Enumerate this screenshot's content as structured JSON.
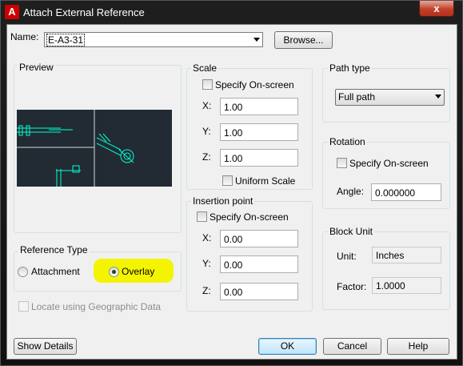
{
  "window": {
    "title": "Attach External Reference",
    "close_glyph": "x"
  },
  "name_field": {
    "label": "Name:",
    "value": "E-A3-31",
    "browse_label": "Browse..."
  },
  "preview": {
    "title": "Preview"
  },
  "reference_type": {
    "title": "Reference Type",
    "options": [
      {
        "label": "Attachment",
        "selected": false
      },
      {
        "label": "Overlay",
        "selected": true
      }
    ],
    "highlight_color": "#f4f400"
  },
  "geo": {
    "label": "Locate using Geographic Data",
    "enabled": false
  },
  "scale": {
    "title": "Scale",
    "specify_label": "Specify On-screen",
    "x_label": "X:",
    "x_value": "1.00",
    "y_label": "Y:",
    "y_value": "1.00",
    "z_label": "Z:",
    "z_value": "1.00",
    "uniform_label": "Uniform Scale"
  },
  "insertion": {
    "title": "Insertion point",
    "specify_label": "Specify On-screen",
    "x_label": "X:",
    "x_value": "0.00",
    "y_label": "Y:",
    "y_value": "0.00",
    "z_label": "Z:",
    "z_value": "0.00"
  },
  "path_type": {
    "title": "Path type",
    "value": "Full path"
  },
  "rotation": {
    "title": "Rotation",
    "specify_label": "Specify On-screen",
    "angle_label": "Angle:",
    "angle_value": "0.000000"
  },
  "block_unit": {
    "title": "Block Unit",
    "unit_label": "Unit:",
    "unit_value": "Inches",
    "factor_label": "Factor:",
    "factor_value": "1.0000"
  },
  "footer": {
    "show_details": "Show Details",
    "ok": "OK",
    "cancel": "Cancel",
    "help": "Help"
  },
  "colors": {
    "cad_background": "#222b33",
    "cad_lines": "#00ffd0",
    "title_bar": "#1a1a1a",
    "close_button": "#c2402a"
  }
}
